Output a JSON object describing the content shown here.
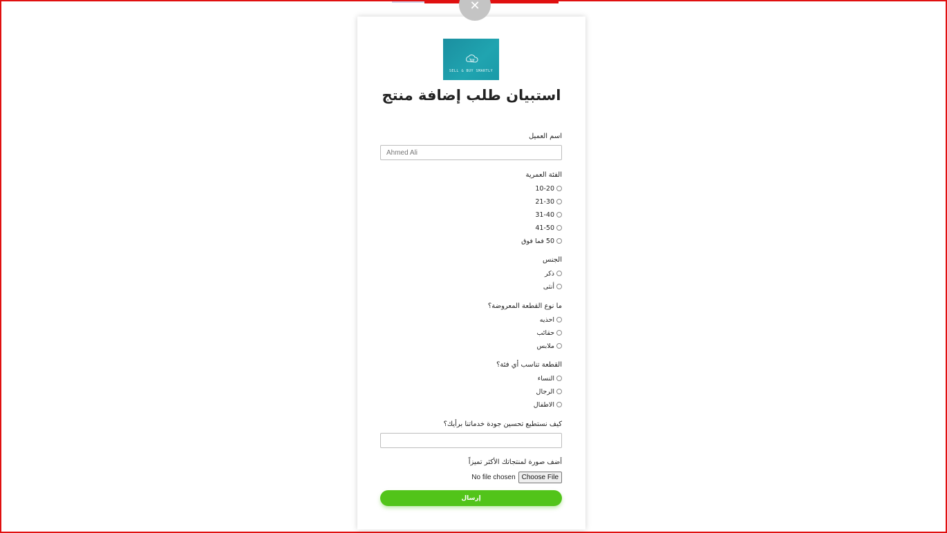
{
  "logo": {
    "text": "SELL & BUY SMARTLY"
  },
  "form": {
    "title": "استبيان طلب إضافة منتج",
    "name": {
      "label": "اسم العميل",
      "value": "Ahmed Ali"
    },
    "age": {
      "label": "الفئة العمرية",
      "options": [
        "10-20",
        "21-30",
        "31-40",
        "41-50",
        "50 فما فوق"
      ]
    },
    "gender": {
      "label": "الجنس",
      "options": [
        "ذكر",
        "أنثى"
      ]
    },
    "item_type": {
      "label": "ما نوع القطعة المعروضة؟",
      "options": [
        "احذيه",
        "حقائب",
        "ملابس"
      ]
    },
    "audience": {
      "label": "القطعة تناسب أي فئة؟",
      "options": [
        "النساء",
        "الرجال",
        "الاطفال"
      ]
    },
    "improve": {
      "label": "كيف نستطيع تحسين جودة خدماتنا برأيك؟",
      "value": ""
    },
    "photo": {
      "label": "أضف صورة لمنتجاتك الأكثر تميزاً",
      "status": "No file chosen",
      "button": "Choose File"
    },
    "submit_label": "إرسال"
  },
  "colors": {
    "accent": "#52c41a",
    "logo_bg": "#1b8fa0",
    "frame": "#e01010"
  },
  "icons": {
    "close": "close-icon"
  }
}
